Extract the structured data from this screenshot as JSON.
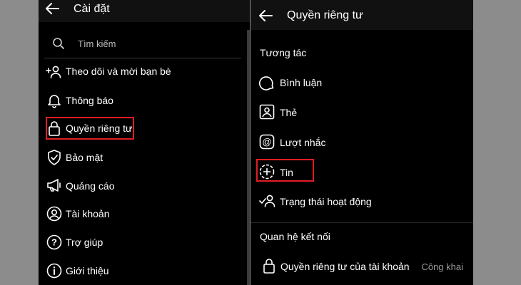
{
  "left_screen": {
    "title": "Cài đặt",
    "search_placeholder": "Tìm kiếm",
    "items": [
      {
        "label": "Theo dõi và mời bạn bè",
        "icon": "add-person-icon"
      },
      {
        "label": "Thông báo",
        "icon": "bell-icon"
      },
      {
        "label": "Quyền riêng tư",
        "icon": "lock-icon"
      },
      {
        "label": "Bảo mật",
        "icon": "shield-check-icon"
      },
      {
        "label": "Quảng cáo",
        "icon": "megaphone-icon"
      },
      {
        "label": "Tài khoản",
        "icon": "person-circle-icon"
      },
      {
        "label": "Trợ giúp",
        "icon": "question-circle-icon"
      },
      {
        "label": "Giới thiệu",
        "icon": "info-circle-icon"
      }
    ]
  },
  "right_screen": {
    "title": "Quyền riêng tư",
    "section_interactions": "Tương tác",
    "items": [
      {
        "label": "Bình luận",
        "icon": "comment-icon"
      },
      {
        "label": "Thẻ",
        "icon": "tag-person-icon"
      },
      {
        "label": "Lượt nhắc",
        "icon": "at-sign-icon"
      },
      {
        "label": "Tin",
        "icon": "story-add-icon"
      },
      {
        "label": "Trạng thái hoạt động",
        "icon": "activity-status-icon"
      }
    ],
    "section_connections": "Quan hệ kết nối",
    "account_privacy": {
      "label": "Quyền riêng tư của tài khoản",
      "value": "Công khai",
      "icon": "lock-icon"
    }
  },
  "highlight_color": "#e11d24"
}
